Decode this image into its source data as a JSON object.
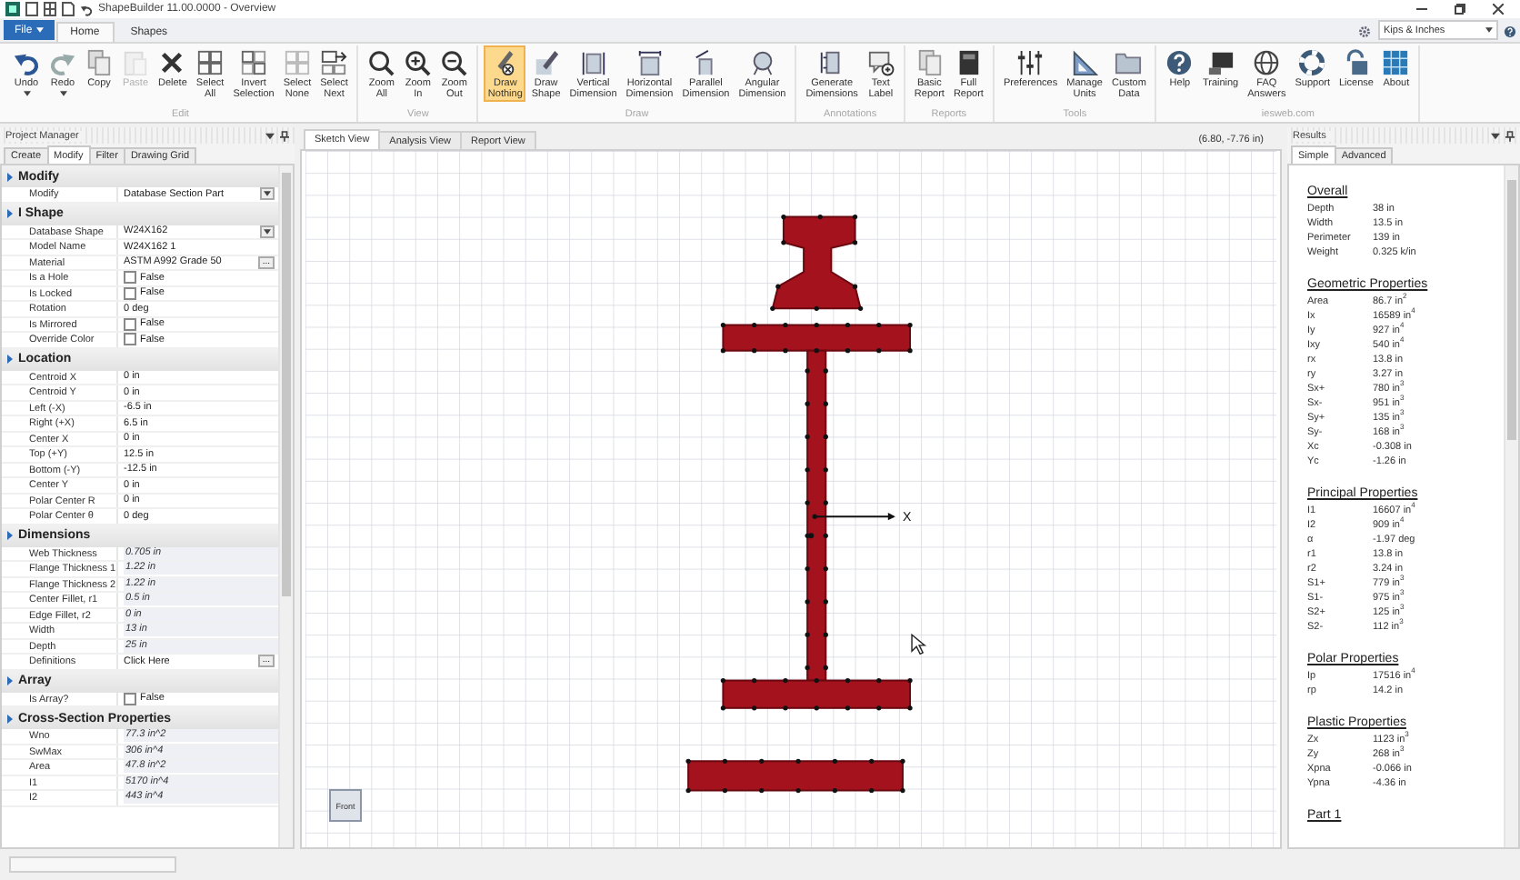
{
  "window": {
    "title": "ShapeBuilder 11.00.0000 - Overview"
  },
  "file_menu": {
    "label": "File"
  },
  "ribbon_tabs": [
    {
      "label": "Home",
      "selected": true
    },
    {
      "label": "Shapes",
      "selected": false
    }
  ],
  "units": {
    "value": "Kips & Inches"
  },
  "ribbon_groups": [
    {
      "label": "Edit",
      "buttons": [
        {
          "label": "Undo",
          "dropdown": true,
          "disabled": false,
          "selected": false
        },
        {
          "label": "Redo",
          "dropdown": true,
          "disabled": false,
          "selected": false
        },
        {
          "label": "Copy",
          "dropdown": false,
          "disabled": false,
          "selected": false
        },
        {
          "label": "Paste",
          "dropdown": false,
          "disabled": true,
          "selected": false
        },
        {
          "label": "Delete",
          "dropdown": false,
          "disabled": false,
          "selected": false
        },
        {
          "label": "Select All",
          "dropdown": false,
          "disabled": false,
          "selected": false
        },
        {
          "label": "Invert Selection",
          "dropdown": false,
          "disabled": false,
          "selected": false
        },
        {
          "label": "Select None",
          "dropdown": false,
          "disabled": false,
          "selected": false
        },
        {
          "label": "Select Next",
          "dropdown": false,
          "disabled": false,
          "selected": false
        }
      ]
    },
    {
      "label": "View",
      "buttons": [
        {
          "label": "Zoom All",
          "dropdown": false,
          "disabled": false,
          "selected": false
        },
        {
          "label": "Zoom In",
          "dropdown": false,
          "disabled": false,
          "selected": false
        },
        {
          "label": "Zoom Out",
          "dropdown": false,
          "disabled": false,
          "selected": false
        }
      ]
    },
    {
      "label": "Draw",
      "buttons": [
        {
          "label": "Draw Nothing",
          "dropdown": false,
          "disabled": false,
          "selected": true
        },
        {
          "label": "Draw Shape",
          "dropdown": false,
          "disabled": false,
          "selected": false
        },
        {
          "label": "Vertical Dimension",
          "dropdown": false,
          "disabled": false,
          "selected": false
        },
        {
          "label": "Horizontal Dimension",
          "dropdown": false,
          "disabled": false,
          "selected": false
        },
        {
          "label": "Parallel Dimension",
          "dropdown": false,
          "disabled": false,
          "selected": false
        },
        {
          "label": "Angular Dimension",
          "dropdown": false,
          "disabled": false,
          "selected": false
        }
      ]
    },
    {
      "label": "Annotations",
      "buttons": [
        {
          "label": "Generate Dimensions",
          "dropdown": false,
          "disabled": false,
          "selected": false
        },
        {
          "label": "Text Label",
          "dropdown": false,
          "disabled": false,
          "selected": false
        }
      ]
    },
    {
      "label": "Reports",
      "buttons": [
        {
          "label": "Basic Report",
          "dropdown": false,
          "disabled": false,
          "selected": false
        },
        {
          "label": "Full Report",
          "dropdown": false,
          "disabled": false,
          "selected": false
        }
      ]
    },
    {
      "label": "Tools",
      "buttons": [
        {
          "label": "Preferences",
          "dropdown": false,
          "disabled": false,
          "selected": false
        },
        {
          "label": "Manage Units",
          "dropdown": false,
          "disabled": false,
          "selected": false
        },
        {
          "label": "Custom Data",
          "dropdown": false,
          "disabled": false,
          "selected": false
        }
      ]
    },
    {
      "label": "iesweb.com",
      "buttons": [
        {
          "label": "Help",
          "dropdown": false,
          "disabled": false,
          "selected": false
        },
        {
          "label": "Training",
          "dropdown": false,
          "disabled": false,
          "selected": false
        },
        {
          "label": "FAQ Answers",
          "dropdown": false,
          "disabled": false,
          "selected": false
        },
        {
          "label": "Support",
          "dropdown": false,
          "disabled": false,
          "selected": false
        },
        {
          "label": "License",
          "dropdown": false,
          "disabled": false,
          "selected": false
        },
        {
          "label": "About",
          "dropdown": false,
          "disabled": false,
          "selected": false
        }
      ]
    }
  ],
  "project_manager": {
    "title": "Project Manager",
    "tabs": [
      {
        "label": "Create",
        "selected": false
      },
      {
        "label": "Modify",
        "selected": true
      },
      {
        "label": "Filter",
        "selected": false
      },
      {
        "label": "Drawing Grid",
        "selected": false
      }
    ],
    "sections": [
      {
        "title": "Modify",
        "rows": [
          {
            "name": "Modify",
            "kind": "dropdown",
            "value": "Database Section Part"
          }
        ]
      },
      {
        "title": "I Shape",
        "rows": [
          {
            "name": "Database Shape",
            "kind": "dropdown",
            "value": "W24X162"
          },
          {
            "name": "Model Name",
            "kind": "text",
            "value": "W24X162 1"
          },
          {
            "name": "Material",
            "kind": "button",
            "value": "ASTM A992 Grade 50",
            "button": "..."
          },
          {
            "name": "Is a Hole",
            "kind": "checkbox",
            "checked": false,
            "value": "False"
          },
          {
            "name": "Is Locked",
            "kind": "checkbox",
            "checked": false,
            "value": "False"
          },
          {
            "name": "Rotation",
            "kind": "text",
            "value": "0 deg"
          },
          {
            "name": "Is Mirrored",
            "kind": "checkbox",
            "checked": false,
            "value": "False"
          },
          {
            "name": "Override Color",
            "kind": "checkbox",
            "checked": false,
            "value": "False"
          }
        ]
      },
      {
        "title": "Location",
        "rows": [
          {
            "name": "Centroid X",
            "kind": "text",
            "value": "0 in"
          },
          {
            "name": "Centroid Y",
            "kind": "text",
            "value": "0 in"
          },
          {
            "name": "Left (-X)",
            "kind": "text",
            "value": "-6.5 in"
          },
          {
            "name": "Right (+X)",
            "kind": "text",
            "value": "6.5 in"
          },
          {
            "name": "Center X",
            "kind": "text",
            "value": "0 in"
          },
          {
            "name": "Top (+Y)",
            "kind": "text",
            "value": "12.5 in"
          },
          {
            "name": "Bottom (-Y)",
            "kind": "text",
            "value": "-12.5 in"
          },
          {
            "name": "Center Y",
            "kind": "text",
            "value": "0 in"
          },
          {
            "name": "Polar Center R",
            "kind": "text",
            "value": "0 in"
          },
          {
            "name": "Polar Center θ",
            "kind": "text",
            "value": "0 deg"
          }
        ]
      },
      {
        "title": "Dimensions",
        "rows": [
          {
            "name": "Web Thickness",
            "kind": "field",
            "value": "0.705 in"
          },
          {
            "name": "Flange Thickness 1",
            "kind": "field",
            "value": "1.22 in"
          },
          {
            "name": "Flange Thickness 2",
            "kind": "field",
            "value": "1.22 in"
          },
          {
            "name": "Center Fillet, r1",
            "kind": "field",
            "value": "0.5 in"
          },
          {
            "name": "Edge Fillet, r2",
            "kind": "field",
            "value": "0 in"
          },
          {
            "name": "Width",
            "kind": "field",
            "value": "13 in"
          },
          {
            "name": "Depth",
            "kind": "field",
            "value": "25 in"
          },
          {
            "name": "Definitions",
            "kind": "button",
            "value": "Click Here",
            "button": "..."
          }
        ]
      },
      {
        "title": "Array",
        "rows": [
          {
            "name": "Is Array?",
            "kind": "checkbox",
            "checked": false,
            "value": "False"
          }
        ]
      },
      {
        "title": "Cross-Section Properties",
        "rows": [
          {
            "name": "Wno",
            "kind": "field",
            "value": "77.3 in^2"
          },
          {
            "name": "SwMax",
            "kind": "field",
            "value": "306 in^4"
          },
          {
            "name": "Area",
            "kind": "field",
            "value": "47.8 in^2"
          },
          {
            "name": "I1",
            "kind": "field",
            "value": "5170 in^4"
          },
          {
            "name": "I2",
            "kind": "field",
            "value": "443 in^4"
          }
        ]
      }
    ]
  },
  "views": [
    {
      "label": "Sketch View",
      "selected": true
    },
    {
      "label": "Analysis View",
      "selected": false
    },
    {
      "label": "Report View",
      "selected": false
    }
  ],
  "coordinates": "(6.80, -7.76 in)",
  "axis_label": "X",
  "view_button": "Front",
  "results": {
    "title": "Results",
    "tabs": [
      {
        "label": "Simple",
        "selected": true
      },
      {
        "label": "Advanced",
        "selected": false
      }
    ],
    "sections": [
      {
        "title": "Overall",
        "rows": [
          {
            "name": "Depth",
            "value": "38 in"
          },
          {
            "name": "Width",
            "value": "13.5 in"
          },
          {
            "name": "Perimeter",
            "value": "139 in"
          },
          {
            "name": "Weight",
            "value": "0.325 k/in"
          }
        ]
      },
      {
        "title": "Geometric Properties",
        "rows": [
          {
            "name": "Area",
            "value": "86.7 in$^{2}$"
          },
          {
            "name": "Ix",
            "value": "16589 in$^{4}$"
          },
          {
            "name": "Iy",
            "value": "927 in$^{4}$"
          },
          {
            "name": "Ixy",
            "value": "540 in$^{4}$"
          },
          {
            "name": "rx",
            "value": "13.8 in"
          },
          {
            "name": "ry",
            "value": "3.27 in"
          },
          {
            "name": "Sx+",
            "value": "780 in$^{3}$"
          },
          {
            "name": "Sx-",
            "value": "951 in$^{3}$"
          },
          {
            "name": "Sy+",
            "value": "135 in$^{3}$"
          },
          {
            "name": "Sy-",
            "value": "168 in$^{3}$"
          },
          {
            "name": "Xc",
            "value": "-0.308 in"
          },
          {
            "name": "Yc",
            "value": "-1.26 in"
          }
        ]
      },
      {
        "title": "Principal Properties",
        "rows": [
          {
            "name": "I1",
            "value": "16607 in$^{4}$"
          },
          {
            "name": "I2",
            "value": "909 in$^{4}$"
          },
          {
            "name": "α",
            "value": "-1.97 deg"
          },
          {
            "name": "r1",
            "value": "13.8 in"
          },
          {
            "name": "r2",
            "value": "3.24 in"
          },
          {
            "name": "S1+",
            "value": "779 in$^{3}$"
          },
          {
            "name": "S1-",
            "value": "975 in$^{3}$"
          },
          {
            "name": "S2+",
            "value": "125 in$^{3}$"
          },
          {
            "name": "S2-",
            "value": "112 in$^{3}$"
          }
        ]
      },
      {
        "title": "Polar Properties",
        "rows": [
          {
            "name": "Ip",
            "value": "17516 in$^{4}$"
          },
          {
            "name": "rp",
            "value": "14.2 in"
          }
        ]
      },
      {
        "title": "Plastic Properties",
        "rows": [
          {
            "name": "Zx",
            "value": "1123 in$^{3}$"
          },
          {
            "name": "Zy",
            "value": "268 in$^{3}$"
          },
          {
            "name": "Xpna",
            "value": "-0.066 in"
          },
          {
            "name": "Ypna",
            "value": "-4.36 in"
          }
        ]
      },
      {
        "title": "Part 1"
      }
    ]
  }
}
